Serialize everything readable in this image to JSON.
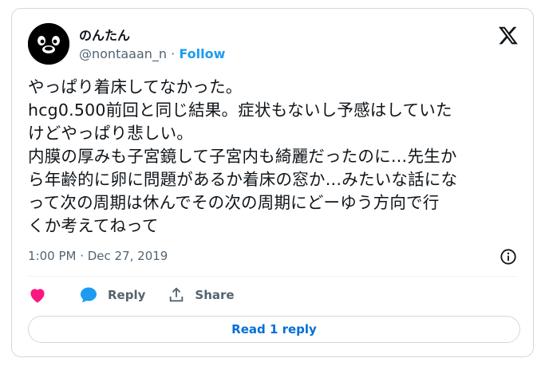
{
  "tweet": {
    "display_name": "のんたん",
    "handle": "@nontaaan_n",
    "separator": "·",
    "follow_label": "Follow",
    "text": "やっぱり着床してなかった。\nhcg0.500前回と同じ結果。症状もないし予感はしていた\nけどやっぱり悲しい。\n内膜の厚みも子宮鏡して子宮内も綺麗だったのに…先生か\nら年齢的に卵に問題があるか着床の窓か…みたいな話にな\nって次の周期は休んでその次の周期にどーゆう方向で行\nくか考えてねって",
    "timestamp": "1:00 PM · Dec 27, 2019"
  },
  "actions": {
    "like_icon": "heart-icon",
    "reply_label": "Reply",
    "share_label": "Share"
  },
  "read_reply_label": "Read 1 reply",
  "colors": {
    "accent": "#1d9bf0",
    "link": "#006fd6",
    "like": "#f91880",
    "muted": "#536471",
    "border": "#cfd9de"
  }
}
